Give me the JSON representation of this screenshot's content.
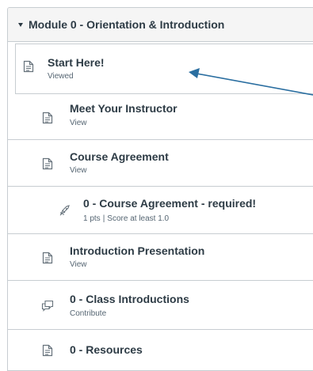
{
  "module": {
    "title": "Module 0 - Orientation & Introduction"
  },
  "items": [
    {
      "title": "Start Here!",
      "sub": "Viewed",
      "icon": "page-icon"
    },
    {
      "title": "Meet Your Instructor",
      "sub": "View",
      "icon": "page-icon"
    },
    {
      "title": "Course Agreement",
      "sub": "View",
      "icon": "page-icon"
    },
    {
      "title": "0 - Course Agreement - required!",
      "pts": "1 pts",
      "score": "Score at least 1.0",
      "icon": "quiz-rocket-icon"
    },
    {
      "title": "Introduction Presentation",
      "sub": "View",
      "icon": "page-icon"
    },
    {
      "title": "0 - Class Introductions",
      "sub": "Contribute",
      "icon": "discussion-icon"
    },
    {
      "title": "0 - Resources",
      "sub": "",
      "icon": "page-icon"
    }
  ],
  "colors": {
    "text": "#2d3b45",
    "border": "#c7cdd1",
    "header_bg": "#f5f5f5",
    "arrow": "#2a6ea0"
  }
}
